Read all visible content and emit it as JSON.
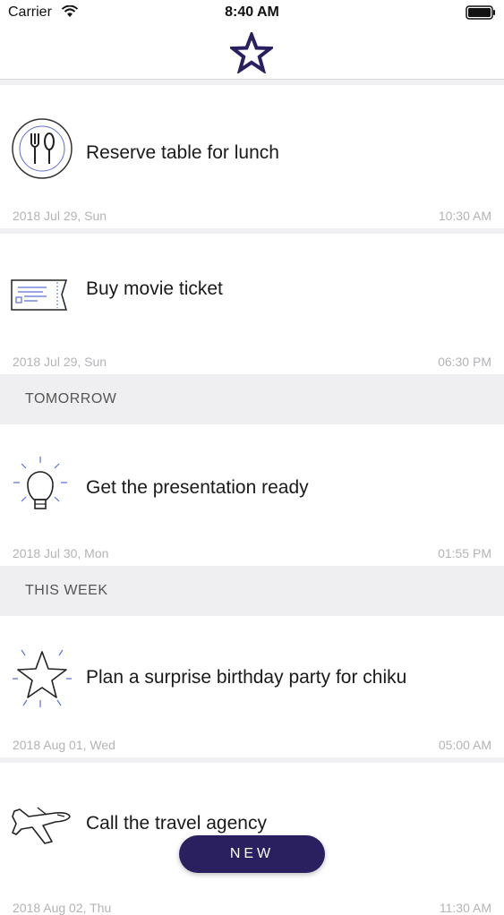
{
  "status": {
    "carrier": "Carrier",
    "time": "8:40 AM"
  },
  "colors": {
    "accent": "#2a2060",
    "section_bg": "#efeff1",
    "meta_text": "#b4b4b8"
  },
  "tasks": [
    {
      "title": "Reserve table for lunch",
      "date": "2018 Jul 29,  Sun",
      "time": "10:30 AM",
      "icon": "restaurant-plate-icon"
    },
    {
      "title": "Buy movie ticket",
      "date": "2018 Jul 29,  Sun",
      "time": "06:30 PM",
      "icon": "ticket-icon"
    },
    {
      "title": "Get the presentation ready",
      "date": "2018 Jul 30,  Mon",
      "time": "01:55 PM",
      "icon": "lightbulb-icon"
    },
    {
      "title": "Plan a surprise birthday party for chiku",
      "date": "2018 Aug 01,  Wed",
      "time": "05:00 AM",
      "icon": "star-icon"
    },
    {
      "title": "Call the travel agency",
      "date": "2018 Aug 02,  Thu",
      "time": "11:30 AM",
      "icon": "airplane-icon"
    }
  ],
  "sections": {
    "tomorrow": "TOMORROW",
    "this_week": "THIS WEEK"
  },
  "new_button": {
    "label": "NEW"
  }
}
